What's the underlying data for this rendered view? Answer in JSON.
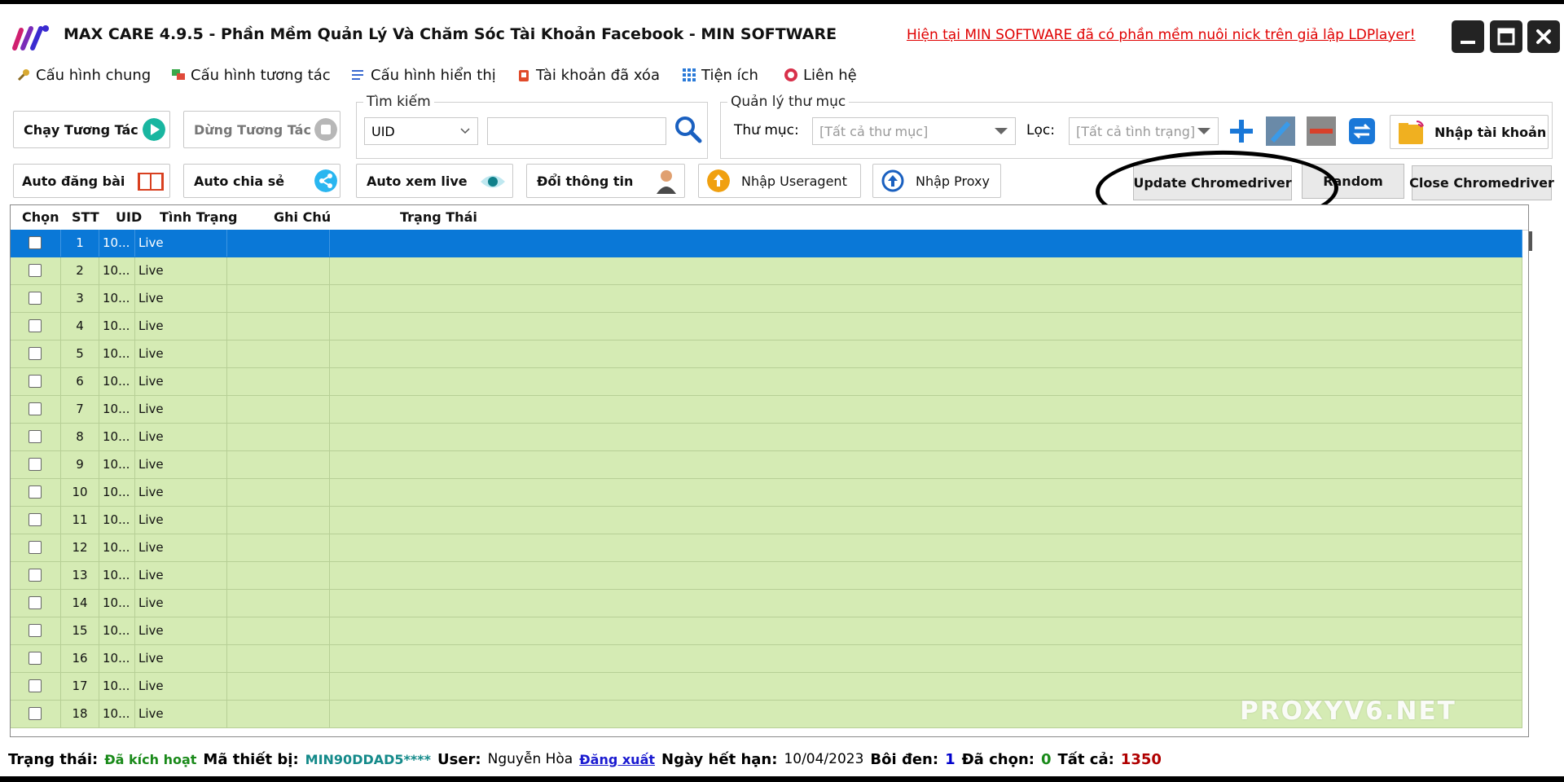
{
  "app": {
    "title": "MAX CARE 4.9.5 - Phần Mềm Quản Lý Và Chăm Sóc Tài Khoản Facebook - MIN SOFTWARE",
    "promo": "Hiện tại MIN SOFTWARE đã có phần mềm nuôi nick trên giả lập LDPlayer!"
  },
  "menu": [
    {
      "label": "Cấu hình chung",
      "icon": "wrench-icon"
    },
    {
      "label": "Cấu hình tương tác",
      "icon": "chat-icon"
    },
    {
      "label": "Cấu hình hiển thị",
      "icon": "list-icon"
    },
    {
      "label": "Tài khoản đã xóa",
      "icon": "trash-icon"
    },
    {
      "label": "Tiện ích",
      "icon": "grid-icon"
    },
    {
      "label": "Liên hệ",
      "icon": "lifebuoy-icon"
    }
  ],
  "toolbar": {
    "run": "Chạy Tương Tác",
    "stop": "Dừng Tương Tác",
    "auto_post": "Auto đăng bài",
    "auto_share": "Auto chia sẻ",
    "auto_live": "Auto xem live",
    "change_info": "Đổi thông tin",
    "import_useragent": "Nhập Useragent",
    "import_proxy": "Nhập Proxy",
    "update_chromedriver": "Update Chromedriver",
    "random": "Random",
    "close_chromedriver": "Close Chromedriver",
    "import_account": "Nhập tài khoản"
  },
  "search": {
    "legend": "Tìm kiếm",
    "field": "UID",
    "value": ""
  },
  "folder": {
    "legend": "Quản lý thư mục",
    "folder_label": "Thư mục:",
    "folder_value": "[Tất cả thư mục]",
    "filter_label": "Lọc:",
    "filter_value": "[Tất cả tình trạng]"
  },
  "grid": {
    "columns": [
      "Chọn",
      "STT",
      "UID",
      "Tình Trạng",
      "Ghi Chú",
      "Trạng Thái"
    ],
    "rows": [
      {
        "stt": "1",
        "uid": "10...",
        "status": "Live"
      },
      {
        "stt": "2",
        "uid": "10...",
        "status": "Live"
      },
      {
        "stt": "3",
        "uid": "10...",
        "status": "Live"
      },
      {
        "stt": "4",
        "uid": "10...",
        "status": "Live"
      },
      {
        "stt": "5",
        "uid": "10...",
        "status": "Live"
      },
      {
        "stt": "6",
        "uid": "10...",
        "status": "Live"
      },
      {
        "stt": "7",
        "uid": "10...",
        "status": "Live"
      },
      {
        "stt": "8",
        "uid": "10...",
        "status": "Live"
      },
      {
        "stt": "9",
        "uid": "10...",
        "status": "Live"
      },
      {
        "stt": "10",
        "uid": "10...",
        "status": "Live"
      },
      {
        "stt": "11",
        "uid": "10...",
        "status": "Live"
      },
      {
        "stt": "12",
        "uid": "10...",
        "status": "Live"
      },
      {
        "stt": "13",
        "uid": "10...",
        "status": "Live"
      },
      {
        "stt": "14",
        "uid": "10...",
        "status": "Live"
      },
      {
        "stt": "15",
        "uid": "10...",
        "status": "Live"
      },
      {
        "stt": "16",
        "uid": "10...",
        "status": "Live"
      },
      {
        "stt": "17",
        "uid": "10...",
        "status": "Live"
      },
      {
        "stt": "18",
        "uid": "10...",
        "status": "Live"
      }
    ]
  },
  "watermark": "PROXYV6.NET",
  "status": {
    "state_label": "Trạng thái:",
    "state_value": "Đã kích hoạt",
    "device_label": "Mã thiết bị:",
    "device_value": "MIN90DDAD5****",
    "user_label": "User:",
    "user_value": "Nguyễn Hòa",
    "logout": "Đăng xuất",
    "expiry_label": "Ngày hết hạn:",
    "expiry_value": "10/04/2023",
    "highlight_label": "Bôi đen:",
    "highlight_value": "1",
    "selected_label": "Đã chọn:",
    "selected_value": "0",
    "total_label": "Tất cả:",
    "total_value": "1350"
  },
  "colors": {
    "row_bg": "#d5ebb4",
    "selected_row": "#0a78d7",
    "promo": "#e00000",
    "status_active": "#1a8a1a",
    "device": "#148a8a",
    "highlight": "#0000cc",
    "selected": "#1a8a1a",
    "total": "#b00000"
  }
}
